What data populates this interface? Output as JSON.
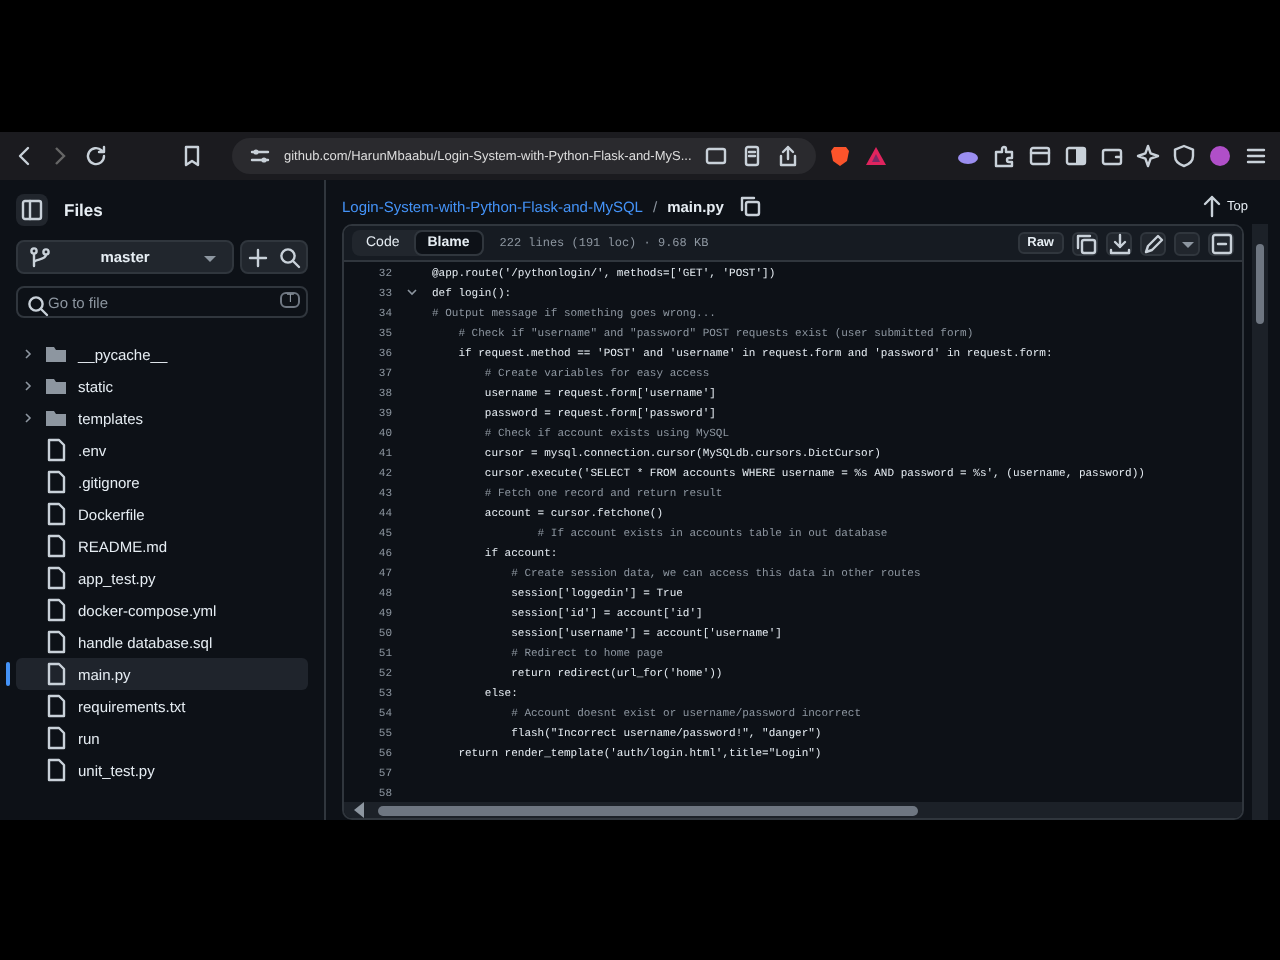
{
  "browser": {
    "url": "github.com/HarunMbaabu/Login-System-with-Python-Flask-and-MyS..."
  },
  "sidebar": {
    "title": "Files",
    "branch": "master",
    "search": {
      "placeholder": "Go to file",
      "shortcut": "T"
    },
    "items": [
      {
        "kind": "folder",
        "label": "__pycache__",
        "selected": false
      },
      {
        "kind": "folder",
        "label": "static",
        "selected": false
      },
      {
        "kind": "folder",
        "label": "templates",
        "selected": false
      },
      {
        "kind": "file",
        "label": ".env",
        "selected": false
      },
      {
        "kind": "file",
        "label": ".gitignore",
        "selected": false
      },
      {
        "kind": "file",
        "label": "Dockerfile",
        "selected": false
      },
      {
        "kind": "file",
        "label": "README.md",
        "selected": false
      },
      {
        "kind": "file",
        "label": "app_test.py",
        "selected": false
      },
      {
        "kind": "file",
        "label": "docker-compose.yml",
        "selected": false
      },
      {
        "kind": "file",
        "label": "handle database.sql",
        "selected": false
      },
      {
        "kind": "file",
        "label": "main.py",
        "selected": true
      },
      {
        "kind": "file",
        "label": "requirements.txt",
        "selected": false
      },
      {
        "kind": "file",
        "label": "run",
        "selected": false
      },
      {
        "kind": "file",
        "label": "unit_test.py",
        "selected": false
      }
    ]
  },
  "breadcrumb": {
    "repo": "Login-System-with-Python-Flask-and-MySQL",
    "separator": "/",
    "file": "main.py"
  },
  "top_link": "Top",
  "tabs": [
    {
      "label": "Code",
      "selected": false
    },
    {
      "label": "Blame",
      "selected": true
    }
  ],
  "file_info": "222 lines (191 loc) · 9.68 KB",
  "raw_button": "Raw",
  "code": [
    {
      "number": "32",
      "kind": "code",
      "text": "@app.route('/pythonlogin/', methods=['GET', 'POST'])"
    },
    {
      "number": "33",
      "kind": "fold",
      "expanded": true,
      "text": "def login():"
    },
    {
      "number": "34",
      "kind": "comment",
      "text": "# Output message if something goes wrong..."
    },
    {
      "number": "35",
      "kind": "comment",
      "text": "    # Check if \"username\" and \"password\" POST requests exist (user submitted form)"
    },
    {
      "number": "36",
      "kind": "code",
      "text": "    if request.method == 'POST' and 'username' in request.form and 'password' in request.form:"
    },
    {
      "number": "37",
      "kind": "comment",
      "text": "        # Create variables for easy access"
    },
    {
      "number": "38",
      "kind": "code",
      "text": "        username = request.form['username']"
    },
    {
      "number": "39",
      "kind": "code",
      "text": "        password = request.form['password']"
    },
    {
      "number": "40",
      "kind": "comment",
      "text": "        # Check if account exists using MySQL"
    },
    {
      "number": "41",
      "kind": "code",
      "text": "        cursor = mysql.connection.cursor(MySQLdb.cursors.DictCursor)"
    },
    {
      "number": "42",
      "kind": "code",
      "text": "        cursor.execute('SELECT * FROM accounts WHERE username = %s AND password = %s', (username, password))"
    },
    {
      "number": "43",
      "kind": "comment",
      "text": "        # Fetch one record and return result"
    },
    {
      "number": "44",
      "kind": "code",
      "text": "        account = cursor.fetchone()"
    },
    {
      "number": "45",
      "kind": "comment",
      "text": "                # If account exists in accounts table in out database"
    },
    {
      "number": "46",
      "kind": "code",
      "text": "        if account:"
    },
    {
      "number": "47",
      "kind": "comment",
      "text": "            # Create session data, we can access this data in other routes"
    },
    {
      "number": "48",
      "kind": "code",
      "text": "            session['loggedin'] = True"
    },
    {
      "number": "49",
      "kind": "code",
      "text": "            session['id'] = account['id']"
    },
    {
      "number": "50",
      "kind": "code",
      "text": "            session['username'] = account['username']"
    },
    {
      "number": "51",
      "kind": "comment",
      "text": "            # Redirect to home page"
    },
    {
      "number": "52",
      "kind": "code",
      "text": "            return redirect(url_for('home'))"
    },
    {
      "number": "53",
      "kind": "code",
      "text": "        else:"
    },
    {
      "number": "54",
      "kind": "comment",
      "text": "            # Account doesnt exist or username/password incorrect"
    },
    {
      "number": "55",
      "kind": "code",
      "text": "            flash(\"Incorrect username/password!\", \"danger\")"
    },
    {
      "number": "56",
      "kind": "code",
      "text": "    return render_template('auth/login.html',title=\"Login\")"
    },
    {
      "number": "57",
      "kind": "blank"
    },
    {
      "number": "58",
      "kind": "blank"
    }
  ]
}
